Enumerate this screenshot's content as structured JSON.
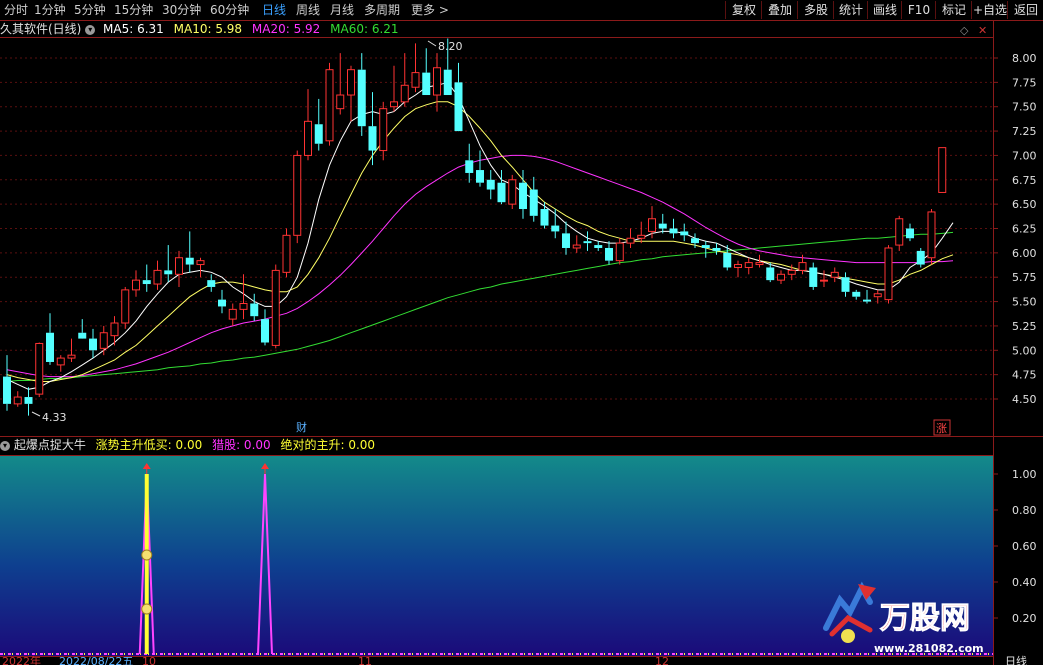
{
  "toolbar": {
    "periods": [
      "分时",
      "1分钟",
      "5分钟",
      "15分钟",
      "30分钟",
      "60分钟",
      "日线",
      "周线",
      "月线",
      "多周期",
      "更多 >"
    ],
    "active_period": "日线",
    "right_buttons": [
      "复权",
      "叠加",
      "多股",
      "统计",
      "画线",
      "F10",
      "标记",
      "+自选",
      "返回"
    ]
  },
  "main_chart": {
    "title": "久其软件(日线)",
    "ma_labels": [
      {
        "text": "MA5: 6.31",
        "color": "#ffffff"
      },
      {
        "text": "MA10: 5.98",
        "color": "#ffff66"
      },
      {
        "text": "MA20: 5.92",
        "color": "#ff33ff"
      },
      {
        "text": "MA60: 6.21",
        "color": "#33dd33"
      }
    ],
    "y_ticks": [
      "8.00",
      "7.75",
      "7.50",
      "7.25",
      "7.00",
      "6.75",
      "6.50",
      "6.25",
      "6.00",
      "5.75",
      "5.50",
      "5.25",
      "5.00",
      "4.75",
      "4.50"
    ],
    "high_label": "8.20",
    "low_label": "4.33",
    "marker_cai": "财",
    "marker_zhang": "涨"
  },
  "indicator": {
    "title": "起爆点捉大牛",
    "items": [
      {
        "text": "涨势主升低买: 0.00",
        "color": "#ffff33"
      },
      {
        "text": "猎股: 0.00",
        "color": "#ff33ff"
      },
      {
        "text": "绝对的主升: 0.00",
        "color": "#ffff33"
      }
    ],
    "y_ticks": [
      "1.00",
      "0.80",
      "0.60",
      "0.40",
      "0.20"
    ]
  },
  "bottom": {
    "date_label": "2022/08/22五",
    "fragment_left": "2022年",
    "axis_mark_1": "10",
    "axis_mark_2": "11",
    "axis_mark_3": "12",
    "period_label": "日线"
  },
  "watermark": {
    "brand": "万股网",
    "url": "www.281082.com"
  },
  "colors": {
    "up": "#ff3333",
    "down": "#54ffff",
    "frame": "#8b1a1a",
    "ma5": "#ffffff",
    "ma10": "#ffff66",
    "ma20": "#ff33ff",
    "ma60": "#33dd33"
  },
  "chart_data": {
    "type": "candlestick",
    "ylim": [
      4.33,
      8.2
    ],
    "candles": [
      [
        4.73,
        4.95,
        4.38,
        4.45
      ],
      [
        4.45,
        4.58,
        4.42,
        4.52
      ],
      [
        4.52,
        4.62,
        4.33,
        4.45
      ],
      [
        4.55,
        5.08,
        4.52,
        5.07
      ],
      [
        5.18,
        5.38,
        4.85,
        4.88
      ],
      [
        4.85,
        4.95,
        4.78,
        4.92
      ],
      [
        4.92,
        5.12,
        4.88,
        4.95
      ],
      [
        5.18,
        5.32,
        5.15,
        5.12
      ],
      [
        5.12,
        5.22,
        4.92,
        5.0
      ],
      [
        5.02,
        5.25,
        4.95,
        5.18
      ],
      [
        5.15,
        5.35,
        5.05,
        5.28
      ],
      [
        5.28,
        5.65,
        5.22,
        5.62
      ],
      [
        5.62,
        5.82,
        5.55,
        5.72
      ],
      [
        5.72,
        5.88,
        5.6,
        5.68
      ],
      [
        5.68,
        5.92,
        5.62,
        5.82
      ],
      [
        5.82,
        6.08,
        5.7,
        5.78
      ],
      [
        5.78,
        6.02,
        5.65,
        5.95
      ],
      [
        5.95,
        6.22,
        5.8,
        5.88
      ],
      [
        5.88,
        5.95,
        5.75,
        5.92
      ],
      [
        5.72,
        5.78,
        5.6,
        5.65
      ],
      [
        5.52,
        5.62,
        5.38,
        5.45
      ],
      [
        5.32,
        5.48,
        5.25,
        5.42
      ],
      [
        5.42,
        5.78,
        5.32,
        5.48
      ],
      [
        5.48,
        5.58,
        5.3,
        5.35
      ],
      [
        5.32,
        5.42,
        5.05,
        5.08
      ],
      [
        5.05,
        5.88,
        5.02,
        5.82
      ],
      [
        5.8,
        6.25,
        5.75,
        6.18
      ],
      [
        6.18,
        7.05,
        6.1,
        7.0
      ],
      [
        7.0,
        7.68,
        6.95,
        7.35
      ],
      [
        7.32,
        7.58,
        7.05,
        7.12
      ],
      [
        7.15,
        7.95,
        7.1,
        7.88
      ],
      [
        7.48,
        8.05,
        7.42,
        7.62
      ],
      [
        7.62,
        7.92,
        7.35,
        7.88
      ],
      [
        7.88,
        8.05,
        7.2,
        7.3
      ],
      [
        7.3,
        7.65,
        6.9,
        7.05
      ],
      [
        7.05,
        7.55,
        6.95,
        7.48
      ],
      [
        7.5,
        7.92,
        7.45,
        7.55
      ],
      [
        7.55,
        8.05,
        7.5,
        7.72
      ],
      [
        7.7,
        8.15,
        7.65,
        7.85
      ],
      [
        7.85,
        8.1,
        7.65,
        7.62
      ],
      [
        7.62,
        8.05,
        7.45,
        7.9
      ],
      [
        7.88,
        8.2,
        7.75,
        7.62
      ],
      [
        7.75,
        7.95,
        7.35,
        7.25
      ],
      [
        6.95,
        7.12,
        6.72,
        6.82
      ],
      [
        6.85,
        7.05,
        6.68,
        6.72
      ],
      [
        6.75,
        6.85,
        6.55,
        6.65
      ],
      [
        6.72,
        6.85,
        6.5,
        6.52
      ],
      [
        6.5,
        6.8,
        6.45,
        6.75
      ],
      [
        6.72,
        6.85,
        6.35,
        6.45
      ],
      [
        6.65,
        6.78,
        6.32,
        6.38
      ],
      [
        6.45,
        6.52,
        6.25,
        6.28
      ],
      [
        6.28,
        6.45,
        6.15,
        6.22
      ],
      [
        6.2,
        6.32,
        5.98,
        6.05
      ],
      [
        6.05,
        6.18,
        6.0,
        6.08
      ],
      [
        6.12,
        6.22,
        6.02,
        6.1
      ],
      [
        6.08,
        6.12,
        6.02,
        6.05
      ],
      [
        6.05,
        6.12,
        5.88,
        5.92
      ],
      [
        5.92,
        6.15,
        5.88,
        6.1
      ],
      [
        6.1,
        6.25,
        6.05,
        6.15
      ],
      [
        6.15,
        6.32,
        6.1,
        6.18
      ],
      [
        6.22,
        6.48,
        6.15,
        6.35
      ],
      [
        6.3,
        6.4,
        6.2,
        6.25
      ],
      [
        6.25,
        6.35,
        6.15,
        6.2
      ],
      [
        6.22,
        6.3,
        6.12,
        6.18
      ],
      [
        6.15,
        6.2,
        6.05,
        6.1
      ],
      [
        6.08,
        6.12,
        5.95,
        6.05
      ],
      [
        6.05,
        6.1,
        5.98,
        6.02
      ],
      [
        6.0,
        6.08,
        5.82,
        5.85
      ],
      [
        5.85,
        5.92,
        5.75,
        5.88
      ],
      [
        5.85,
        5.95,
        5.78,
        5.9
      ],
      [
        5.88,
        5.98,
        5.85,
        5.9
      ],
      [
        5.85,
        5.9,
        5.7,
        5.72
      ],
      [
        5.72,
        5.82,
        5.68,
        5.78
      ],
      [
        5.78,
        5.88,
        5.72,
        5.82
      ],
      [
        5.82,
        5.98,
        5.78,
        5.9
      ],
      [
        5.85,
        5.9,
        5.62,
        5.65
      ],
      [
        5.72,
        5.82,
        5.65,
        5.72
      ],
      [
        5.75,
        5.85,
        5.7,
        5.8
      ],
      [
        5.75,
        5.8,
        5.55,
        5.6
      ],
      [
        5.6,
        5.62,
        5.52,
        5.55
      ],
      [
        5.52,
        5.62,
        5.48,
        5.5
      ],
      [
        5.55,
        5.62,
        5.48,
        5.58
      ],
      [
        5.52,
        6.08,
        5.48,
        6.05
      ],
      [
        6.08,
        6.38,
        6.02,
        6.35
      ],
      [
        6.25,
        6.3,
        6.12,
        6.15
      ],
      [
        6.02,
        6.05,
        5.85,
        5.88
      ],
      [
        5.95,
        6.45,
        5.88,
        6.42
      ],
      [
        6.62,
        7.08,
        6.62,
        7.08
      ]
    ],
    "ma5": [
      4.7,
      4.65,
      4.6,
      4.62,
      4.68,
      4.72,
      4.78,
      4.85,
      4.92,
      5.0,
      5.08,
      5.18,
      5.3,
      5.45,
      5.58,
      5.7,
      5.78,
      5.8,
      5.82,
      5.8,
      5.75,
      5.65,
      5.58,
      5.5,
      5.45,
      5.45,
      5.55,
      5.75,
      6.1,
      6.55,
      6.9,
      7.15,
      7.35,
      7.42,
      7.45,
      7.42,
      7.45,
      7.55,
      7.62,
      7.7,
      7.72,
      7.75,
      7.6,
      7.35,
      7.1,
      6.9,
      6.75,
      6.7,
      6.62,
      6.55,
      6.48,
      6.4,
      6.3,
      6.22,
      6.15,
      6.12,
      6.1,
      6.1,
      6.12,
      6.15,
      6.2,
      6.22,
      6.22,
      6.2,
      6.15,
      6.12,
      6.1,
      6.05,
      6.0,
      5.95,
      5.92,
      5.88,
      5.85,
      5.82,
      5.82,
      5.8,
      5.78,
      5.75,
      5.72,
      5.68,
      5.65,
      5.62,
      5.62,
      5.7,
      5.85,
      5.92,
      6.0,
      6.15,
      6.31
    ],
    "ma10": [
      4.75,
      4.72,
      4.7,
      4.68,
      4.68,
      4.7,
      4.72,
      4.75,
      4.8,
      4.85,
      4.9,
      4.98,
      5.05,
      5.15,
      5.25,
      5.35,
      5.45,
      5.55,
      5.62,
      5.68,
      5.7,
      5.7,
      5.68,
      5.65,
      5.62,
      5.6,
      5.6,
      5.65,
      5.78,
      5.95,
      6.15,
      6.38,
      6.6,
      6.82,
      7.0,
      7.15,
      7.28,
      7.4,
      7.48,
      7.52,
      7.55,
      7.55,
      7.5,
      7.4,
      7.28,
      7.15,
      7.0,
      6.88,
      6.75,
      6.62,
      6.52,
      6.45,
      6.38,
      6.32,
      6.28,
      6.22,
      6.18,
      6.15,
      6.12,
      6.12,
      6.12,
      6.12,
      6.12,
      6.1,
      6.08,
      6.05,
      6.02,
      6.0,
      5.98,
      5.95,
      5.92,
      5.9,
      5.88,
      5.85,
      5.82,
      5.8,
      5.78,
      5.76,
      5.74,
      5.72,
      5.7,
      5.68,
      5.68,
      5.72,
      5.78,
      5.82,
      5.88,
      5.94,
      5.98
    ],
    "ma20": [
      4.8,
      4.78,
      4.76,
      4.74,
      4.73,
      4.73,
      4.73,
      4.74,
      4.76,
      4.78,
      4.8,
      4.83,
      4.86,
      4.9,
      4.94,
      4.98,
      5.03,
      5.08,
      5.13,
      5.18,
      5.22,
      5.25,
      5.28,
      5.3,
      5.32,
      5.35,
      5.38,
      5.43,
      5.5,
      5.58,
      5.67,
      5.77,
      5.88,
      6.0,
      6.12,
      6.25,
      6.38,
      6.5,
      6.6,
      6.68,
      6.75,
      6.82,
      6.88,
      6.92,
      6.95,
      6.97,
      6.99,
      7.0,
      7.0,
      6.99,
      6.97,
      6.94,
      6.9,
      6.86,
      6.82,
      6.78,
      6.74,
      6.7,
      6.66,
      6.62,
      6.57,
      6.52,
      6.46,
      6.4,
      6.33,
      6.26,
      6.2,
      6.14,
      6.09,
      6.05,
      6.02,
      6.0,
      5.98,
      5.96,
      5.95,
      5.94,
      5.93,
      5.92,
      5.91,
      5.9,
      5.9,
      5.9,
      5.9,
      5.9,
      5.9,
      5.9,
      5.91,
      5.91,
      5.92
    ],
    "ma60": [
      4.68,
      4.69,
      4.69,
      4.7,
      4.71,
      4.71,
      4.72,
      4.73,
      4.74,
      4.75,
      4.76,
      4.77,
      4.78,
      4.79,
      4.8,
      4.82,
      4.83,
      4.84,
      4.86,
      4.87,
      4.89,
      4.9,
      4.92,
      4.93,
      4.95,
      4.97,
      4.99,
      5.01,
      5.04,
      5.07,
      5.1,
      5.14,
      5.18,
      5.22,
      5.26,
      5.3,
      5.34,
      5.38,
      5.42,
      5.46,
      5.5,
      5.54,
      5.57,
      5.6,
      5.63,
      5.65,
      5.68,
      5.7,
      5.72,
      5.74,
      5.76,
      5.78,
      5.8,
      5.82,
      5.84,
      5.86,
      5.88,
      5.9,
      5.91,
      5.93,
      5.94,
      5.96,
      5.97,
      5.98,
      5.99,
      6.0,
      6.01,
      6.02,
      6.03,
      6.04,
      6.05,
      6.06,
      6.07,
      6.08,
      6.09,
      6.1,
      6.11,
      6.12,
      6.13,
      6.14,
      6.15,
      6.15,
      6.16,
      6.17,
      6.18,
      6.19,
      6.19,
      6.2,
      6.21
    ],
    "indicator": {
      "yellow_spike_index": 13,
      "magenta_spike_indices": [
        13,
        24
      ],
      "ylim": [
        0,
        1.1
      ]
    }
  }
}
